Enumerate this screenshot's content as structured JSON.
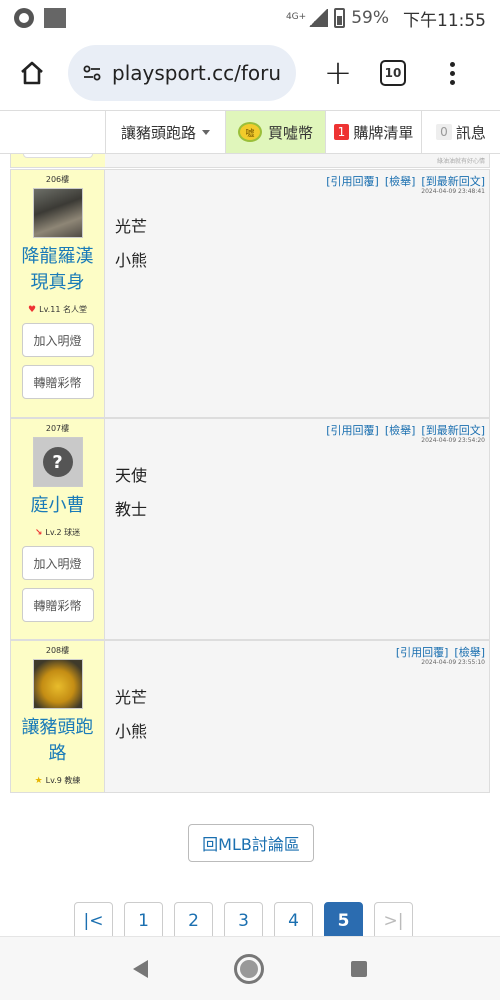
{
  "status_bar": {
    "network": "4G+",
    "battery": "59%",
    "time": "下午11:55"
  },
  "browser": {
    "url": "playsport.cc/foru",
    "tab_count": "10"
  },
  "site_nav": {
    "user": "讓豬頭跑路",
    "buy_coin": "買噓幣",
    "coin_badge": "噓",
    "cart_count": "1",
    "cart": "購牌清單",
    "msg_count": "0",
    "messages": "訊息"
  },
  "prev_post_signature": "綠油油就有好心情",
  "posts": [
    {
      "floor": "206樓",
      "username": "降龍羅漢現真身",
      "level": "Lv.11 名人堂",
      "btn_light": "加入明燈",
      "btn_gift": "轉贈彩幣",
      "actions": [
        "[引用回覆]",
        "[檢舉]",
        "[到最新回文]"
      ],
      "time": "2024-04-09 23:48:41",
      "lines": [
        "光芒",
        "小熊"
      ]
    },
    {
      "floor": "207樓",
      "username": "庭小曹",
      "level": "Lv.2 球迷",
      "btn_light": "加入明燈",
      "btn_gift": "轉贈彩幣",
      "actions": [
        "[引用回覆]",
        "[檢舉]",
        "[到最新回文]"
      ],
      "time": "2024-04-09 23:54:20",
      "lines": [
        "天使",
        "教士"
      ]
    },
    {
      "floor": "208樓",
      "username": "讓豬頭跑路",
      "level": "Lv.9 教練",
      "actions": [
        "[引用回覆]",
        "[檢舉]"
      ],
      "time": "2024-04-09 23:55:10",
      "lines": [
        "光芒",
        "小熊"
      ]
    }
  ],
  "back_button": "回MLB討論區",
  "pagination": {
    "first": "|<",
    "pages": [
      "1",
      "2",
      "3",
      "4",
      "5"
    ],
    "current": "5",
    "last": ">|"
  }
}
